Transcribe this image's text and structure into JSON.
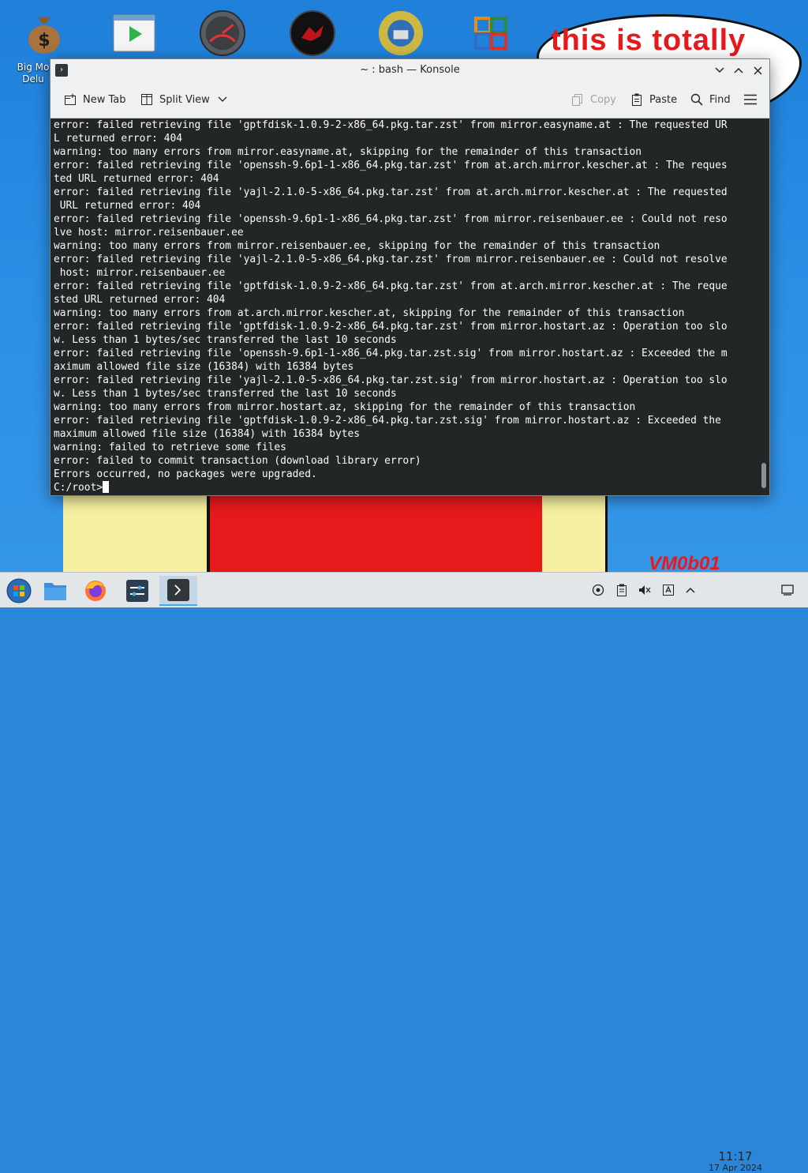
{
  "desktop": {
    "icon_label": "Big Mo\nDelu",
    "bubble_text": "this is totally",
    "watermark": "VM0b01",
    "icons": [
      "money-bag-icon",
      "media-player-icon",
      "speedometer-icon",
      "red-orb-icon",
      "sun-globe-icon",
      "office-grid-icon"
    ]
  },
  "window": {
    "title": "~ : bash — Konsole",
    "toolbar": {
      "new_tab": "New Tab",
      "split_view": "Split View",
      "copy": "Copy",
      "paste": "Paste",
      "find": "Find"
    }
  },
  "terminal": {
    "lines": [
      "error: failed retrieving file 'gptfdisk-1.0.9-2-x86_64.pkg.tar.zst' from mirror.easyname.at : The requested UR",
      "L returned error: 404",
      "warning: too many errors from mirror.easyname.at, skipping for the remainder of this transaction",
      "error: failed retrieving file 'openssh-9.6p1-1-x86_64.pkg.tar.zst' from at.arch.mirror.kescher.at : The reques",
      "ted URL returned error: 404",
      "error: failed retrieving file 'yajl-2.1.0-5-x86_64.pkg.tar.zst' from at.arch.mirror.kescher.at : The requested",
      " URL returned error: 404",
      "error: failed retrieving file 'openssh-9.6p1-1-x86_64.pkg.tar.zst' from mirror.reisenbauer.ee : Could not reso",
      "lve host: mirror.reisenbauer.ee",
      "warning: too many errors from mirror.reisenbauer.ee, skipping for the remainder of this transaction",
      "error: failed retrieving file 'yajl-2.1.0-5-x86_64.pkg.tar.zst' from mirror.reisenbauer.ee : Could not resolve",
      " host: mirror.reisenbauer.ee",
      "error: failed retrieving file 'gptfdisk-1.0.9-2-x86_64.pkg.tar.zst' from at.arch.mirror.kescher.at : The reque",
      "sted URL returned error: 404",
      "warning: too many errors from at.arch.mirror.kescher.at, skipping for the remainder of this transaction",
      "error: failed retrieving file 'gptfdisk-1.0.9-2-x86_64.pkg.tar.zst' from mirror.hostart.az : Operation too slo",
      "w. Less than 1 bytes/sec transferred the last 10 seconds",
      "error: failed retrieving file 'openssh-9.6p1-1-x86_64.pkg.tar.zst.sig' from mirror.hostart.az : Exceeded the m",
      "aximum allowed file size (16384) with 16384 bytes",
      "error: failed retrieving file 'yajl-2.1.0-5-x86_64.pkg.tar.zst.sig' from mirror.hostart.az : Operation too slo",
      "w. Less than 1 bytes/sec transferred the last 10 seconds",
      "warning: too many errors from mirror.hostart.az, skipping for the remainder of this transaction",
      "error: failed retrieving file 'gptfdisk-1.0.9-2-x86_64.pkg.tar.zst.sig' from mirror.hostart.az : Exceeded the",
      "maximum allowed file size (16384) with 16384 bytes",
      "warning: failed to retrieve some files",
      "error: failed to commit transaction (download library error)",
      "Errors occurred, no packages were upgraded."
    ],
    "prompt": "C:/root>"
  },
  "taskbar": {
    "clock_time": "11:17",
    "clock_date": "17 Apr 2024"
  }
}
